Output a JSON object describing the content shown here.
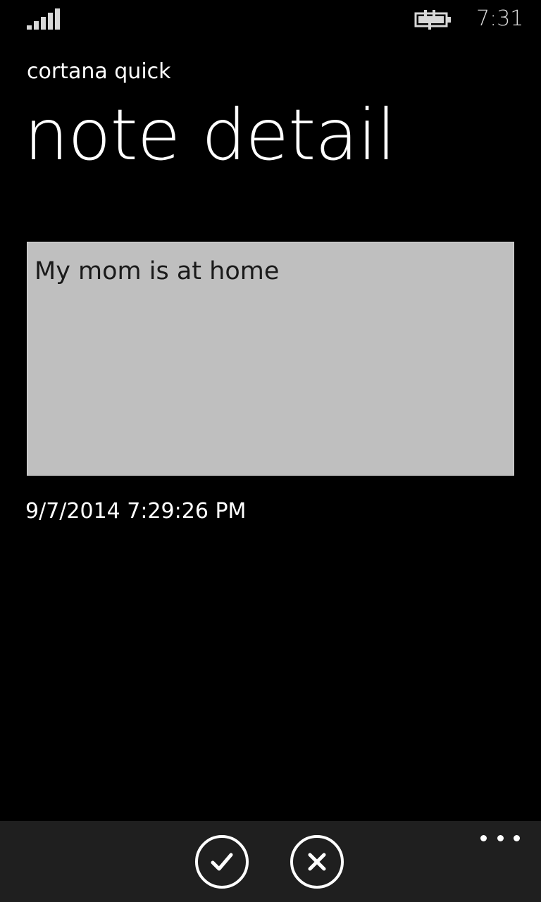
{
  "status_bar": {
    "signal_icon": "signal-strength-icon",
    "battery_icon": "battery-charging-icon",
    "time": "7:31"
  },
  "header": {
    "app_title": "cortana quick",
    "page_title": "note detail"
  },
  "note": {
    "text": "My mom is at home",
    "date": "9/7/2014 7:29:26 PM"
  },
  "app_bar": {
    "buttons": [
      {
        "icon": "checkmark-icon"
      },
      {
        "icon": "close-icon"
      }
    ],
    "more_icon": "ellipsis-icon"
  },
  "colors": {
    "background": "#000000",
    "note_box": "#bfbfbf",
    "app_bar": "#1f1f1f",
    "text": "#ffffff"
  }
}
